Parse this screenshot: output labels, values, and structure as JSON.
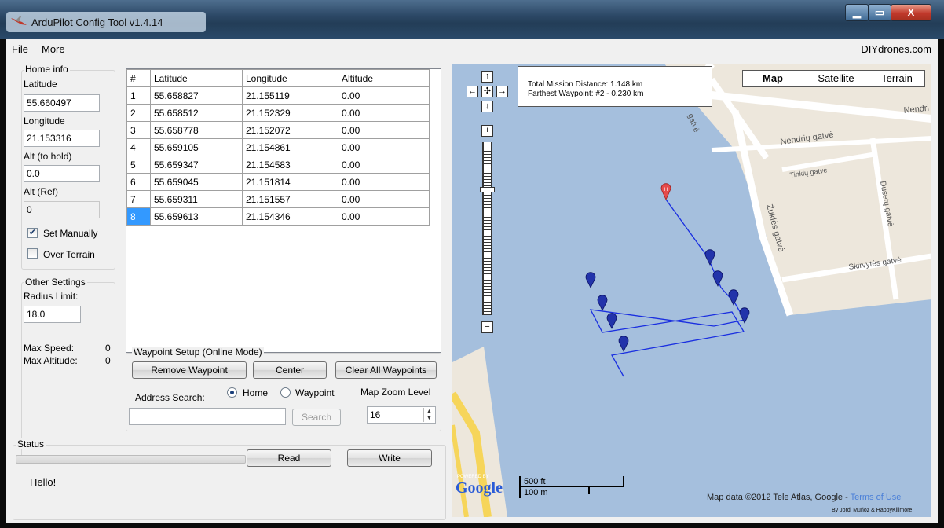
{
  "window": {
    "title": "ArduPilot Config Tool v1.4.14",
    "min_glyph": "▁",
    "max_glyph": "▭",
    "close_glyph": "X"
  },
  "menu": {
    "file": "File",
    "more": "More",
    "site": "DIYdrones.com"
  },
  "home_info": {
    "title": "Home info",
    "latitude_label": "Latitude",
    "latitude": "55.660497",
    "longitude_label": "Longitude",
    "longitude": "21.153316",
    "alt_hold_label": "Alt (to hold)",
    "alt_hold": "0.0",
    "alt_ref_label": "Alt (Ref)",
    "alt_ref": "0",
    "set_manually": "Set Manually",
    "set_manually_checked": true,
    "over_terrain": "Over Terrain",
    "over_terrain_checked": false
  },
  "other_settings": {
    "title": "Other Settings",
    "radius_label": "Radius Limit:",
    "radius": "18.0",
    "max_speed_label": "Max Speed:",
    "max_speed": "0",
    "max_alt_label": "Max Altitude:",
    "max_alt": "0"
  },
  "grid": {
    "headers": [
      "#",
      "Latitude",
      "Longitude",
      "Altitude"
    ],
    "rows": [
      [
        "1",
        "55.658827",
        "21.155119",
        "0.00"
      ],
      [
        "2",
        "55.658512",
        "21.152329",
        "0.00"
      ],
      [
        "3",
        "55.658778",
        "21.152072",
        "0.00"
      ],
      [
        "4",
        "55.659105",
        "21.154861",
        "0.00"
      ],
      [
        "5",
        "55.659347",
        "21.154583",
        "0.00"
      ],
      [
        "6",
        "55.659045",
        "21.151814",
        "0.00"
      ],
      [
        "7",
        "55.659311",
        "21.151557",
        "0.00"
      ],
      [
        "8",
        "55.659613",
        "21.154346",
        "0.00"
      ]
    ],
    "selected_row": 8
  },
  "waypoint_setup": {
    "title": "Waypoint Setup (Online Mode)",
    "remove": "Remove Waypoint",
    "center": "Center",
    "clear": "Clear All Waypoints",
    "address_label": "Address Search:",
    "home": "Home",
    "waypoint": "Waypoint",
    "zoom_label": "Map Zoom Level",
    "zoom": "16",
    "search": "Search",
    "search_value": ""
  },
  "status": {
    "title": "Status",
    "read": "Read",
    "write": "Write",
    "message": "Hello!",
    "progress": 0
  },
  "map": {
    "info_line1": "Total Mission Distance: 1.148 km",
    "info_line2": "Farthest Waypoint: #2 - 0.230 km",
    "tab_map": "Map",
    "tab_satellite": "Satellite",
    "tab_terrain": "Terrain",
    "street1": "Nendrių gatvė",
    "street2": "Nendri",
    "street3": "Tinklų gatvė",
    "street4": "Dusetų gatvė",
    "street5": "Žuklės gatvė",
    "street6": "Skirvytės gatvė",
    "street7": "gatvė",
    "powered_by": "POWERED BY",
    "google": "Google",
    "scale_ft": "500 ft",
    "scale_m": "100 m",
    "attribution": "Map data ©2012 Tele Atlas, Google - ",
    "terms": "Terms of Use",
    "credit": "By Jordi Muñoz & HappyKillmore",
    "home_marker": "H",
    "colors": {
      "water": "#a5bfdd",
      "land": "#ede7dc",
      "road": "#ffffff",
      "highway": "#f6d55a",
      "route": "#1a2fe0"
    }
  }
}
